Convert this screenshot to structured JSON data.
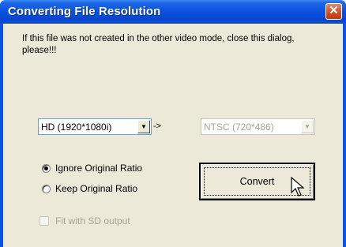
{
  "window": {
    "title": "Converting File Resolution",
    "close_glyph": "✕"
  },
  "message": "If this file was not created in the other video mode, close this dialog, please!!!",
  "source_select": {
    "value": "HD (1920*1080i)"
  },
  "arrow_text": "->",
  "target_select": {
    "value": "NTSC (720*486)",
    "disabled": true
  },
  "ratio_options": [
    {
      "label": "Ignore Original Ratio",
      "selected": true
    },
    {
      "label": "Keep Original Ratio",
      "selected": false
    }
  ],
  "convert_button": {
    "label": "Convert"
  },
  "fit_checkbox": {
    "label": "Fit with SD output",
    "checked": false,
    "disabled": true
  },
  "colors": {
    "titlebar": "#0a54e3",
    "face": "#ece9d8",
    "close": "#d04a22",
    "disabled_text": "#a5a297"
  }
}
